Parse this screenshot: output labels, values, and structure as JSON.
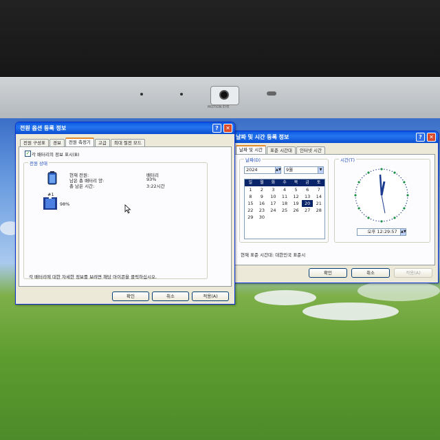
{
  "hardware": {
    "camera_label": "MOTION EYE"
  },
  "power_dialog": {
    "title": "전원 옵션 등록 정보",
    "tabs": [
      "전원 구성표",
      "경보",
      "전원 측정기",
      "고급",
      "최대 절전 모드"
    ],
    "active_tab": 2,
    "show_details_checkbox": {
      "label": "각 배터리의 정보 표시(B)",
      "checked": true
    },
    "group_label": "전원 상태",
    "info_labels": [
      "현재 전원:",
      "남은 총 배터리 양:",
      "총 남은 시간:"
    ],
    "info_values": [
      "배터리",
      "93%",
      "3:22시간"
    ],
    "battery_number": "#1",
    "battery_percent": "98%",
    "hint": "각 배터리에 대한 자세한 정보를 보려면 해당 아이콘을 클릭하십시오.",
    "buttons": {
      "ok": "확인",
      "cancel": "취소",
      "apply": "적용(A)"
    }
  },
  "datetime_dialog": {
    "title": "날짜 및 시간 등록 정보",
    "tabs": [
      "날짜 및 시간",
      "표준 시간대",
      "인터넷 시간"
    ],
    "active_tab": 0,
    "date_group": "날짜(D)",
    "year": "2024",
    "month": "9월",
    "weekdays": [
      "일",
      "월",
      "화",
      "수",
      "목",
      "금",
      "토"
    ],
    "days": [
      "1",
      "2",
      "3",
      "4",
      "5",
      "6",
      "7",
      "8",
      "9",
      "10",
      "11",
      "12",
      "13",
      "14",
      "15",
      "16",
      "17",
      "18",
      "19",
      "20",
      "21",
      "22",
      "23",
      "24",
      "25",
      "26",
      "27",
      "28",
      "29",
      "30"
    ],
    "selected_day": "20",
    "time_group": "시간(T)",
    "time_value": "오후 12:29:57",
    "timezone_text": "현재 표준 시간대: 대한민국 표준시",
    "buttons": {
      "ok": "확인",
      "cancel": "취소",
      "apply": "적용(A)"
    }
  }
}
